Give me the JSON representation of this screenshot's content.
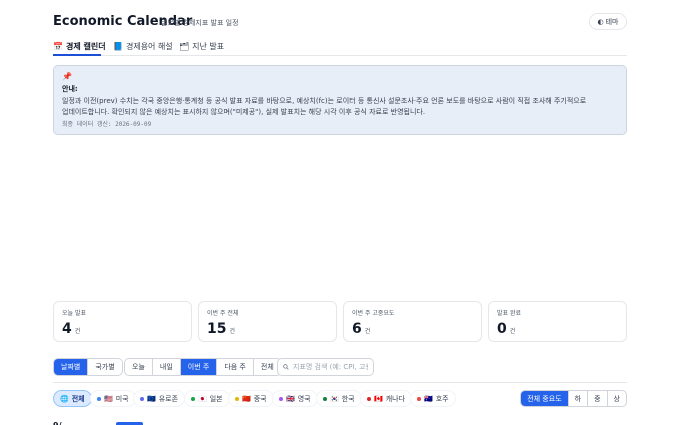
{
  "header": {
    "title": "Economic Calendar",
    "subtitle": "글로벌 경제지표 발표 일정",
    "theme_label": "테마",
    "theme_icon": "◐"
  },
  "tabs": [
    {
      "icon": "📅",
      "label": "경제 캘린더",
      "active": true
    },
    {
      "icon": "📘",
      "label": "경제용어 해설",
      "active": false
    },
    {
      "icon": "🗂",
      "label": "지난 발표",
      "active": false
    }
  ],
  "notice": {
    "icon": "📌",
    "heading": "안내:",
    "body": "일정과 이전(prev) 수치는 각국 중앙은행·통계청 등 공식 발표 자료를 바탕으로, 예상치(fc)는 로이터 등 통신사 설문조사·주요 언론 보도를 바탕으로 사람이 직접 조사해 주기적으로 업데이트합니다. 확인되지 않은 예상치는 표시하지 않으며(\"미제공\"), 실제 발표치는 해당 시각 이후 공식 자료로 반영됩니다.",
    "updated": "최종 데이터 갱신: 2026-09-09"
  },
  "stats": [
    {
      "label": "오늘 발표",
      "value": "4",
      "unit": "건"
    },
    {
      "label": "이번 주 전체",
      "value": "15",
      "unit": "건"
    },
    {
      "label": "이번 주 고중요도",
      "value": "6",
      "unit": "건"
    },
    {
      "label": "발표 완료",
      "value": "0",
      "unit": "건"
    }
  ],
  "view_mode": [
    {
      "label": "날짜별",
      "active": true
    },
    {
      "label": "국가별",
      "active": false
    }
  ],
  "range": [
    {
      "label": "오늘",
      "active": false
    },
    {
      "label": "내일",
      "active": false
    },
    {
      "label": "이번 주",
      "active": true
    },
    {
      "label": "다음 주",
      "active": false
    },
    {
      "label": "전체",
      "active": false
    }
  ],
  "search": {
    "icon": "search-icon",
    "placeholder": "지표명 검색 (예: CPI, 고용"
  },
  "countries": [
    {
      "flag": "🌐",
      "label": "전체",
      "active": true,
      "color": ""
    },
    {
      "flag": "🇺🇸",
      "label": "미국",
      "active": false,
      "color": "#3b82f6"
    },
    {
      "flag": "🇪🇺",
      "label": "유로존",
      "active": false,
      "color": "#6366f1"
    },
    {
      "flag": "🇯🇵",
      "label": "일본",
      "active": false,
      "color": "#16a34a"
    },
    {
      "flag": "🇨🇳",
      "label": "중국",
      "active": false,
      "color": "#eab308"
    },
    {
      "flag": "🇬🇧",
      "label": "영국",
      "active": false,
      "color": "#a855f7"
    },
    {
      "flag": "🇰🇷",
      "label": "한국",
      "active": false,
      "color": "#15803d"
    },
    {
      "flag": "🇨🇦",
      "label": "캐나다",
      "active": false,
      "color": "#dc2626"
    },
    {
      "flag": "🇦🇺",
      "label": "호주",
      "active": false,
      "color": "#ef4444"
    }
  ],
  "importance": [
    {
      "label": "전체 중요도",
      "active": true
    },
    {
      "label": "하",
      "active": false
    },
    {
      "label": "중",
      "active": false
    },
    {
      "label": "상",
      "active": false
    }
  ],
  "peek": {
    "label": "9/"
  },
  "colors": {
    "accent": "#2563eb",
    "notice_bg": "#e8eef7"
  }
}
